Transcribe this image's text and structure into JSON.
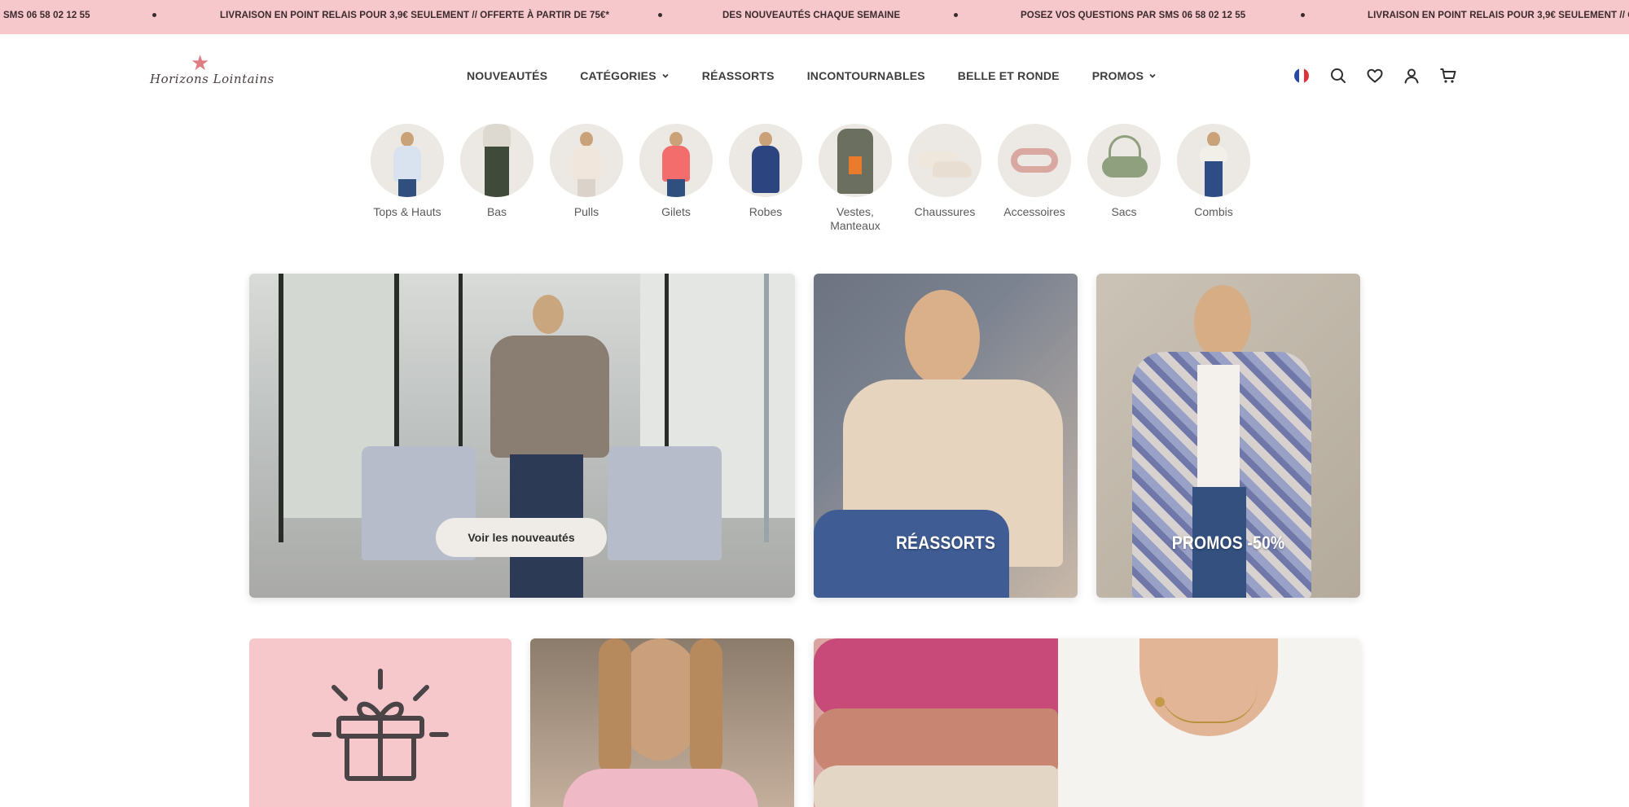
{
  "announcement": {
    "items": [
      "SMS 06 58 02 12 55",
      "LIVRAISON EN POINT RELAIS POUR 3,9€ SEULEMENT // OFFERTE À PARTIR DE 75€*",
      "DES NOUVEAUTÉS CHAQUE SEMAINE",
      "POSEZ VOS QUESTIONS PAR SMS 06 58 02 12 55",
      "LIVRAISON EN POINT RELAIS POUR 3,9€ SEULEMENT // OF"
    ]
  },
  "header": {
    "logo_text": "Horizons Lointains",
    "nav": [
      {
        "label": "NOUVEAUTÉS",
        "dropdown": false
      },
      {
        "label": "CATÉGORIES",
        "dropdown": true
      },
      {
        "label": "RÉASSORTS",
        "dropdown": false
      },
      {
        "label": "INCONTOURNABLES",
        "dropdown": false
      },
      {
        "label": "BELLE ET RONDE",
        "dropdown": false
      },
      {
        "label": "PROMOS",
        "dropdown": true
      }
    ],
    "icons": [
      "french-flag-icon",
      "search-icon",
      "heart-icon",
      "account-icon",
      "cart-icon"
    ]
  },
  "categories": [
    {
      "label": "Tops & Hauts"
    },
    {
      "label": "Bas"
    },
    {
      "label": "Pulls"
    },
    {
      "label": "Gilets"
    },
    {
      "label": "Robes"
    },
    {
      "label": "Vestes, Manteaux"
    },
    {
      "label": "Chaussures"
    },
    {
      "label": "Accessoires"
    },
    {
      "label": "Sacs"
    },
    {
      "label": "Combis"
    }
  ],
  "tiles": {
    "nouveautes_button": "Voir les nouveautés",
    "reassorts_caption": "RÉASSORTS",
    "promos_caption": "PROMOS -50%"
  },
  "colors": {
    "announcement_bg": "#f6c7cb",
    "gift_tile_bg": "#f6c7cb",
    "text_dark": "#3d3d3d"
  }
}
